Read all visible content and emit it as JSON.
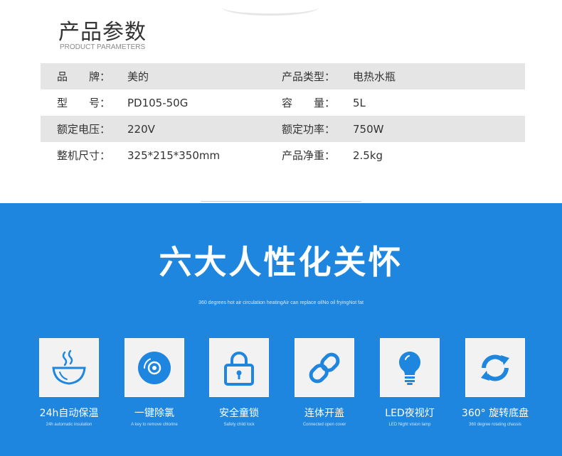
{
  "header": {
    "title_cn": "产品参数",
    "title_en": "PRODUCT PARAMETERS"
  },
  "specs": [
    {
      "label1": "品　　牌：",
      "value1": "美的",
      "label2": "产品类型：",
      "value2": "电热水瓶"
    },
    {
      "label1": "型　　号：",
      "value1": "PD105-50G",
      "label2": "容　　量：",
      "value2": "5L"
    },
    {
      "label1": "额定电压：",
      "value1": "220V",
      "label2": "额定功率：",
      "value2": "750W"
    },
    {
      "label1": "整机尺寸：",
      "value1": "325*215*350mm",
      "label2": "产品净重：",
      "value2": "2.5kg"
    }
  ],
  "care": {
    "title": "六大人性化关怀",
    "subtitle": "360 degrees hot air circulation heatingAir can replace oilNo oil fryingNot fat"
  },
  "features": [
    {
      "icon": "bowl-icon",
      "cn": "24h自动保温",
      "en": "24h automatic insulation"
    },
    {
      "icon": "disc-icon",
      "cn": "一键除氯",
      "en": "A key to remove chlorine"
    },
    {
      "icon": "lock-icon",
      "cn": "安全童锁",
      "en": "Safety child lock"
    },
    {
      "icon": "link-icon",
      "cn": "连体开盖",
      "en": "Connected open cover"
    },
    {
      "icon": "bulb-icon",
      "cn": "LED夜视灯",
      "en": "LED Night vision lamp"
    },
    {
      "icon": "rotate-icon",
      "cn": "360°  旋转底盘",
      "en": "360 degree rotating chassis"
    }
  ],
  "colors": {
    "blue_bg": "#1e86df",
    "icon_blue": "#1e86df",
    "row_shade": "#e5e5e5"
  }
}
